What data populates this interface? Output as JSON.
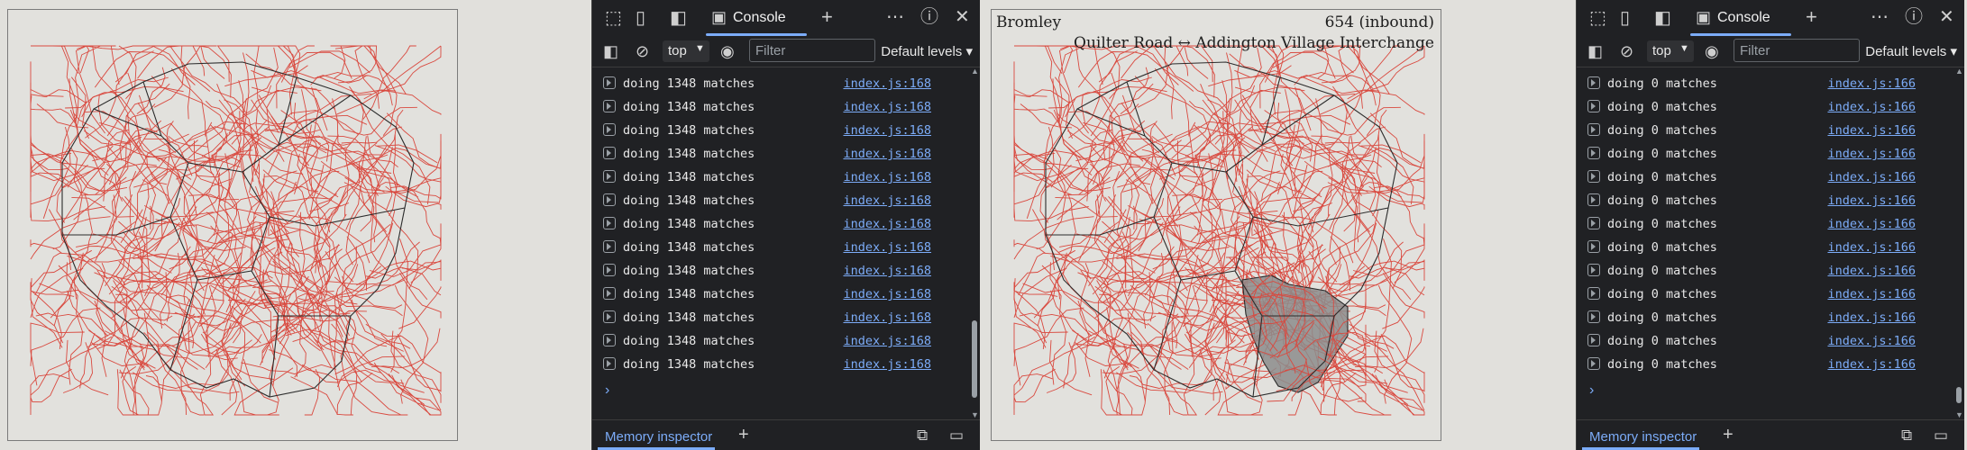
{
  "panes": {
    "map_left": {
      "labels": {}
    },
    "map_right": {
      "labels": {
        "borough": "Bromley",
        "route": "654 (inbound)",
        "stops": "Quilter Road ↔ Addington Village Interchange"
      }
    }
  },
  "devtools_left": {
    "tab": "Console",
    "context": "top",
    "filter_placeholder": "Filter",
    "levels": "Default levels",
    "logs": [
      {
        "msg": "doing 1348 matches",
        "src": "index.js:168"
      },
      {
        "msg": "doing 1348 matches",
        "src": "index.js:168"
      },
      {
        "msg": "doing 1348 matches",
        "src": "index.js:168"
      },
      {
        "msg": "doing 1348 matches",
        "src": "index.js:168"
      },
      {
        "msg": "doing 1348 matches",
        "src": "index.js:168"
      },
      {
        "msg": "doing 1348 matches",
        "src": "index.js:168"
      },
      {
        "msg": "doing 1348 matches",
        "src": "index.js:168"
      },
      {
        "msg": "doing 1348 matches",
        "src": "index.js:168"
      },
      {
        "msg": "doing 1348 matches",
        "src": "index.js:168"
      },
      {
        "msg": "doing 1348 matches",
        "src": "index.js:168"
      },
      {
        "msg": "doing 1348 matches",
        "src": "index.js:168"
      },
      {
        "msg": "doing 1348 matches",
        "src": "index.js:168"
      },
      {
        "msg": "doing 1348 matches",
        "src": "index.js:168"
      }
    ],
    "bottom_tab": "Memory inspector"
  },
  "devtools_right": {
    "tab": "Console",
    "context": "top",
    "filter_placeholder": "Filter",
    "levels": "Default levels",
    "logs": [
      {
        "msg": "doing 0 matches",
        "src": "index.js:166"
      },
      {
        "msg": "doing 0 matches",
        "src": "index.js:166"
      },
      {
        "msg": "doing 0 matches",
        "src": "index.js:166"
      },
      {
        "msg": "doing 0 matches",
        "src": "index.js:166"
      },
      {
        "msg": "doing 0 matches",
        "src": "index.js:166"
      },
      {
        "msg": "doing 0 matches",
        "src": "index.js:166"
      },
      {
        "msg": "doing 0 matches",
        "src": "index.js:166"
      },
      {
        "msg": "doing 0 matches",
        "src": "index.js:166"
      },
      {
        "msg": "doing 0 matches",
        "src": "index.js:166"
      },
      {
        "msg": "doing 0 matches",
        "src": "index.js:166"
      },
      {
        "msg": "doing 0 matches",
        "src": "index.js:166"
      },
      {
        "msg": "doing 0 matches",
        "src": "index.js:166"
      },
      {
        "msg": "doing 0 matches",
        "src": "index.js:166"
      }
    ],
    "bottom_tab": "Memory inspector"
  },
  "colors": {
    "route": "#d9493f",
    "boundary": "#2b2b2b",
    "highlight": "#8c8c8c",
    "link": "#7cacf8"
  },
  "icons": [
    "inspect-icon",
    "device-icon",
    "sidebar-icon",
    "console-tab-icon",
    "add-tab-icon",
    "more-icon",
    "help-icon",
    "close-icon",
    "show-sidebar-icon",
    "clear-icon",
    "eye-icon",
    "caret-down-icon",
    "dock-icon",
    "screenshot-icon"
  ]
}
